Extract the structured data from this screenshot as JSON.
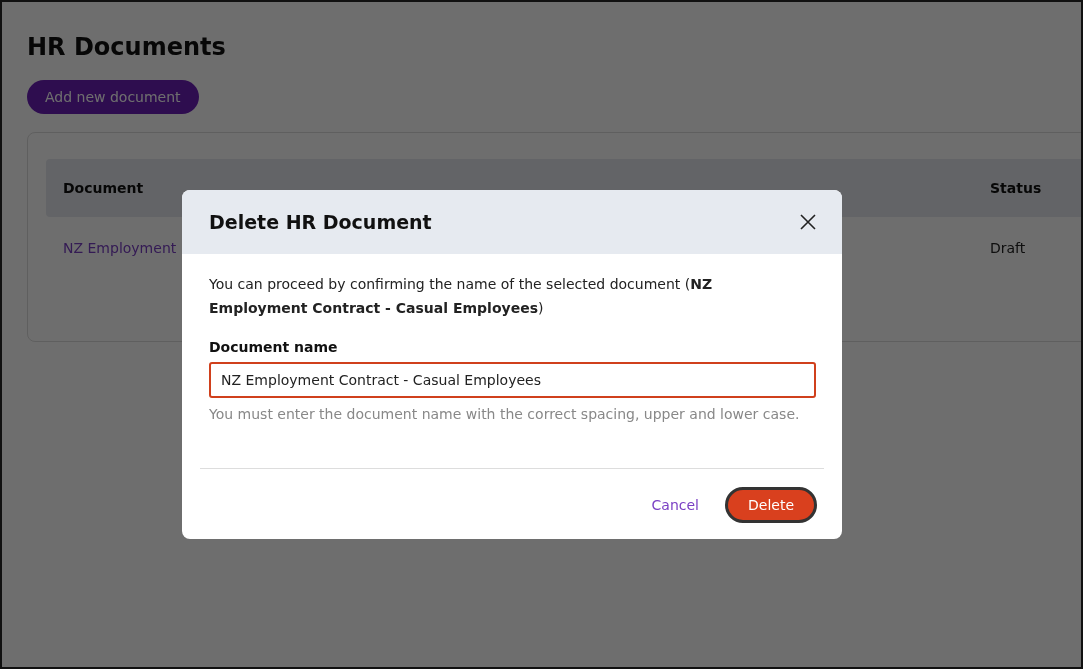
{
  "page": {
    "title": "HR Documents",
    "add_button": "Add new document"
  },
  "table": {
    "columns": [
      "Document",
      "Status"
    ],
    "rows": [
      {
        "document": "NZ Employment",
        "status": "Draft"
      }
    ]
  },
  "dialog": {
    "title": "Delete HR Document",
    "message": "You can proceed by confirming the name of the selected document (**NZ Employment Contract - Casual Employees**)",
    "field": {
      "label": "Document name",
      "value": "NZ Employment Contract - Casual Employees",
      "error": true,
      "hint": "You must enter the document name with the correct spacing, upper and lower case."
    },
    "buttons": {
      "cancel": "Cancel",
      "confirm": "Delete"
    }
  }
}
